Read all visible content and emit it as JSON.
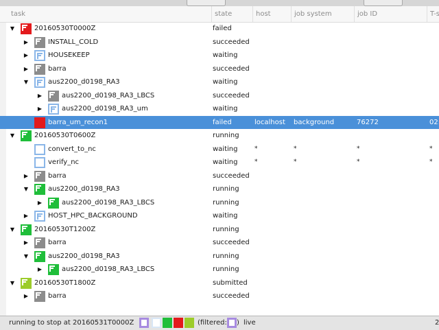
{
  "columns": [
    "task",
    "state",
    "host",
    "job system",
    "job ID",
    "T-s"
  ],
  "rows": [
    {
      "depth": 0,
      "expander": "open",
      "icon": "F",
      "color": "#e31a1c",
      "style": "solid",
      "name": "20160530T0000Z",
      "state": "failed"
    },
    {
      "depth": 1,
      "expander": "closed",
      "icon": "F",
      "color": "#8c8c8c",
      "style": "solid",
      "name": "INSTALL_COLD",
      "state": "succeeded"
    },
    {
      "depth": 1,
      "expander": "closed",
      "icon": "F",
      "color": "#8ab6e8",
      "style": "hollow",
      "name": "HOUSEKEEP",
      "state": "waiting"
    },
    {
      "depth": 1,
      "expander": "closed",
      "icon": "F",
      "color": "#8c8c8c",
      "style": "solid",
      "name": "barra",
      "state": "succeeded"
    },
    {
      "depth": 1,
      "expander": "open",
      "icon": "F",
      "color": "#8ab6e8",
      "style": "hollow",
      "name": "aus2200_d0198_RA3",
      "state": "waiting"
    },
    {
      "depth": 2,
      "expander": "closed",
      "icon": "F",
      "color": "#8c8c8c",
      "style": "solid",
      "name": "aus2200_d0198_RA3_LBCS",
      "state": "succeeded"
    },
    {
      "depth": 2,
      "expander": "closed",
      "icon": "F",
      "color": "#8ab6e8",
      "style": "hollow",
      "name": "aus2200_d0198_RA3_um",
      "state": "waiting"
    },
    {
      "depth": 1,
      "expander": "none",
      "icon": "",
      "color": "#e31a1c",
      "style": "solid",
      "name": "barra_um_recon1",
      "state": "failed",
      "host": "localhost",
      "job_system": "background",
      "job_id": "76272",
      "time": "02:",
      "selected": true
    },
    {
      "depth": 0,
      "expander": "open",
      "icon": "F",
      "color": "#1fbe3a",
      "style": "solid",
      "name": "20160530T0600Z",
      "state": "running"
    },
    {
      "depth": 1,
      "expander": "none",
      "icon": "",
      "color": "#8ab6e8",
      "style": "hollow",
      "name": "convert_to_nc",
      "state": "waiting",
      "host": "*",
      "job_system": "*",
      "job_id": "*",
      "time": "*"
    },
    {
      "depth": 1,
      "expander": "none",
      "icon": "",
      "color": "#8ab6e8",
      "style": "hollow",
      "name": "verify_nc",
      "state": "waiting",
      "host": "*",
      "job_system": "*",
      "job_id": "*",
      "time": "*"
    },
    {
      "depth": 1,
      "expander": "closed",
      "icon": "F",
      "color": "#8c8c8c",
      "style": "solid",
      "name": "barra",
      "state": "succeeded"
    },
    {
      "depth": 1,
      "expander": "open",
      "icon": "F",
      "color": "#1fbe3a",
      "style": "solid",
      "name": "aus2200_d0198_RA3",
      "state": "running"
    },
    {
      "depth": 2,
      "expander": "closed",
      "icon": "F",
      "color": "#1fbe3a",
      "style": "solid",
      "name": "aus2200_d0198_RA3_LBCS",
      "state": "running"
    },
    {
      "depth": 1,
      "expander": "closed",
      "icon": "F",
      "color": "#8ab6e8",
      "style": "hollow",
      "name": "HOST_HPC_BACKGROUND",
      "state": "waiting"
    },
    {
      "depth": 0,
      "expander": "open",
      "icon": "F",
      "color": "#1fbe3a",
      "style": "solid",
      "name": "20160530T1200Z",
      "state": "running"
    },
    {
      "depth": 1,
      "expander": "closed",
      "icon": "F",
      "color": "#8c8c8c",
      "style": "solid",
      "name": "barra",
      "state": "succeeded"
    },
    {
      "depth": 1,
      "expander": "open",
      "icon": "F",
      "color": "#1fbe3a",
      "style": "solid",
      "name": "aus2200_d0198_RA3",
      "state": "running"
    },
    {
      "depth": 2,
      "expander": "closed",
      "icon": "F",
      "color": "#1fbe3a",
      "style": "solid",
      "name": "aus2200_d0198_RA3_LBCS",
      "state": "running"
    },
    {
      "depth": 0,
      "expander": "open",
      "icon": "F",
      "color": "#9ccc2a",
      "style": "solid",
      "name": "20160530T1800Z",
      "state": "submitted"
    },
    {
      "depth": 1,
      "expander": "closed",
      "icon": "F",
      "color": "#8c8c8c",
      "style": "solid",
      "name": "barra",
      "state": "succeeded"
    }
  ],
  "statusbar": {
    "message": "running to stop at 20160531T0000Z",
    "filtered_label": "(filtered:",
    "filtered_close": ")",
    "live_label": "live",
    "right_value": "2",
    "swatches": [
      "#a78be0",
      "#d8e6f6",
      "#1fbe3a",
      "#e31a1c",
      "#9ccc2a"
    ],
    "filtered_swatch": "#a78be0"
  }
}
